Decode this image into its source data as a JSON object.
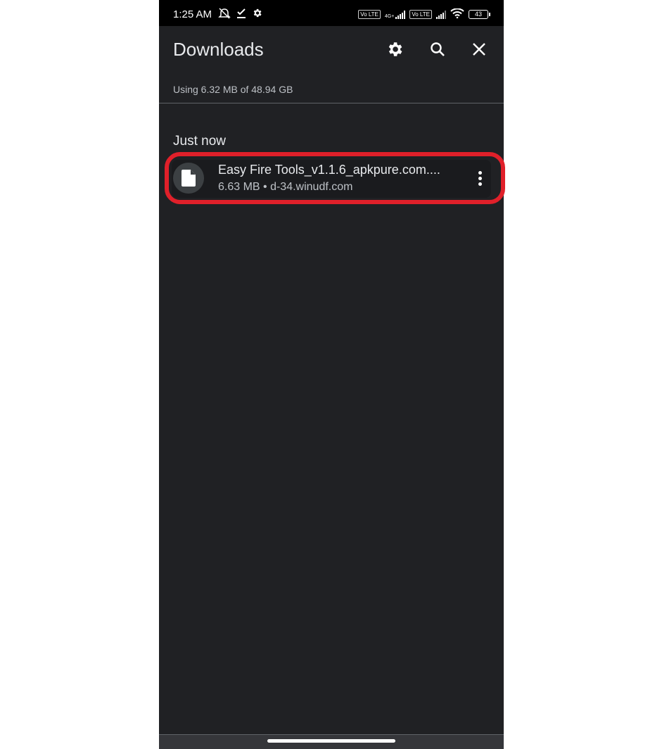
{
  "status_bar": {
    "time": "1:25 AM",
    "icons": [
      "mute-notifications-icon",
      "download-done-icon",
      "settings-icon"
    ],
    "network_1": "4G+",
    "volte_label": "Vo LTE",
    "battery": "43"
  },
  "header": {
    "title": "Downloads",
    "settings_label": "Settings",
    "search_label": "Search",
    "close_label": "Close"
  },
  "storage": {
    "text": "Using 6.32 MB of 48.94 GB"
  },
  "sections": [
    {
      "label": "Just now",
      "items": [
        {
          "name": "Easy Fire Tools_v1.1.6_apkpure.com....",
          "meta": "6.63 MB • d-34.winudf.com",
          "icon": "file-icon",
          "highlighted": true
        }
      ]
    }
  ],
  "colors": {
    "background": "#202124",
    "highlight": "#e0202a",
    "text_primary": "#e8eaed",
    "text_secondary": "#bdc1c6"
  }
}
